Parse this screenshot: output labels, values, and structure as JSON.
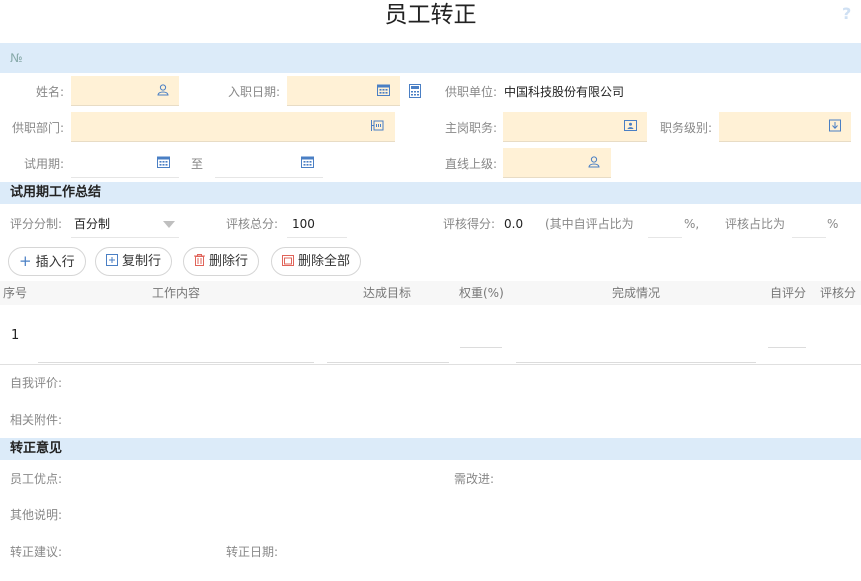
{
  "header": {
    "title": "员工转正",
    "help": "?"
  },
  "number_bar": {
    "label": "№"
  },
  "form": {
    "name_label": "姓名:",
    "entry_date_label": "入职日期:",
    "unit_label": "供职单位:",
    "unit_value": "中国科技股份有限公司",
    "dept_label": "供职部门:",
    "main_post_label": "主岗职务:",
    "post_level_label": "职务级别:",
    "probation_label": "试用期:",
    "to_label": "至",
    "supervisor_label": "直线上级:"
  },
  "summary": {
    "title": "试用期工作总结",
    "scoring_label": "评分分制:",
    "scoring_value": "百分制",
    "total_label": "评核总分:",
    "total_value": "100",
    "score_label": "评核得分:",
    "score_value": "0.0",
    "self_ratio_label": "(其中自评占比为",
    "pct1": "%,",
    "review_ratio_label": "评核占比为",
    "pct2": "%"
  },
  "toolbar": {
    "insert": "插入行",
    "copy": "复制行",
    "delete": "删除行",
    "delete_all": "删除全部"
  },
  "table": {
    "headers": [
      "序号",
      "工作内容",
      "达成目标",
      "权重(%)",
      "完成情况",
      "自评分",
      "评核分"
    ],
    "rows": [
      {
        "index": "1"
      }
    ]
  },
  "self_eval_label": "自我评价:",
  "attachment_label": "相关附件:",
  "opinion": {
    "title": "转正意见",
    "merits_label": "员工优点:",
    "improve_label": "需改进:",
    "other_label": "其他说明:",
    "advice_label": "转正建议:",
    "date_label": "转正日期:"
  },
  "colors": {
    "band": "#dcebf9",
    "field": "#fff1d6",
    "accent": "#4a7fc4"
  }
}
